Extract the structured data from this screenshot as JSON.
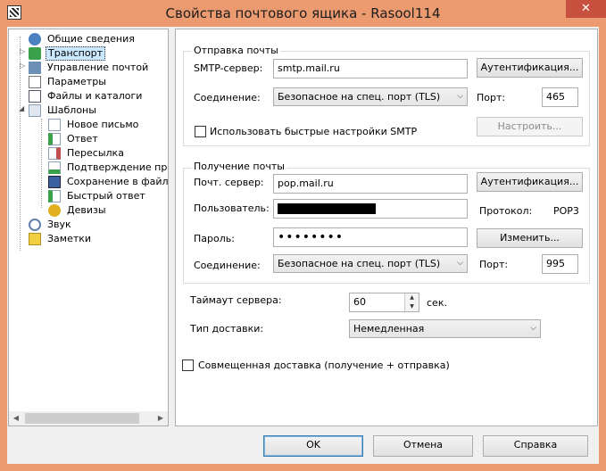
{
  "window": {
    "title": "Свойства почтового ящика - Rasool114",
    "close_glyph": "✕"
  },
  "tree": {
    "items": [
      {
        "label": "Общие сведения",
        "icon": "user-info-icon",
        "color": "#4a7fc0"
      },
      {
        "label": "Транспорт",
        "icon": "transport-icon",
        "color": "#3aa04a"
      },
      {
        "label": "Управление почтой",
        "icon": "mail-management-icon",
        "color": "#6b8fb5"
      },
      {
        "label": "Параметры",
        "icon": "settings-doc-icon",
        "color": "#d0d0d0"
      },
      {
        "label": "Файлы и каталоги",
        "icon": "files-folders-icon",
        "color": "#8fa5b8"
      },
      {
        "label": "Шаблоны",
        "icon": "templates-icon",
        "color": "#8aa0b6"
      },
      {
        "label": "Новое письмо",
        "icon": "new-letter-icon",
        "color": "#8aa0b6"
      },
      {
        "label": "Ответ",
        "icon": "reply-icon",
        "color": "#3aa04a"
      },
      {
        "label": "Пересылка",
        "icon": "forward-icon",
        "color": "#c05050"
      },
      {
        "label": "Подтверждение проч",
        "icon": "read-receipt-icon",
        "color": "#3aa04a"
      },
      {
        "label": "Сохранение в файл",
        "icon": "save-file-icon",
        "color": "#3a60a0"
      },
      {
        "label": "Быстрый ответ",
        "icon": "quick-reply-icon",
        "color": "#3aa04a"
      },
      {
        "label": "Девизы",
        "icon": "mottos-icon",
        "color": "#e0b020"
      },
      {
        "label": "Звук",
        "icon": "sound-icon",
        "color": "#6080b0"
      },
      {
        "label": "Заметки",
        "icon": "notes-icon",
        "color": "#f0d040"
      }
    ]
  },
  "send": {
    "group_title": "Отправка почты",
    "server_label": "SMTP-сервер:",
    "server_value": "smtp.mail.ru",
    "auth_button": "Аутентификация...",
    "connection_label": "Соединение:",
    "connection_value": "Безопасное на спец. порт (TLS)",
    "port_label": "Порт:",
    "port_value": "465",
    "fast_smtp_label": "Использовать быстрые настройки SMTP",
    "configure_button": "Настроить..."
  },
  "receive": {
    "group_title": "Получение почты",
    "server_label": "Почт. сервер:",
    "server_value": "pop.mail.ru",
    "auth_button": "Аутентификация...",
    "user_label": "Пользователь:",
    "protocol_label": "Протокол:",
    "protocol_value": "POP3",
    "password_label": "Пароль:",
    "password_value": "••••••••",
    "change_button": "Изменить...",
    "connection_label": "Соединение:",
    "connection_value": "Безопасное на спец. порт (TLS)",
    "port_label": "Порт:",
    "port_value": "995"
  },
  "timeout": {
    "label": "Таймаут сервера:",
    "value": "60",
    "unit": "сек."
  },
  "delivery": {
    "label": "Тип доставки:",
    "value": "Немедленная"
  },
  "combined": {
    "label": "Совмещенная доставка (получение + отправка)"
  },
  "buttons": {
    "ok": "OK",
    "cancel": "Отмена",
    "help": "Справка"
  }
}
